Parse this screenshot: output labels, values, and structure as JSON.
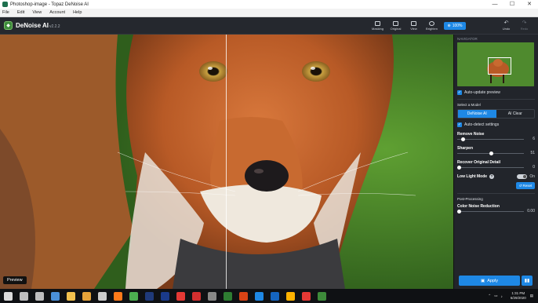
{
  "window": {
    "title": "Photoshop-image - Topaz DeNoise AI",
    "controls": {
      "minimize": "—",
      "maximize": "☐",
      "close": "✕"
    }
  },
  "menu": [
    "File",
    "Edit",
    "View",
    "Account",
    "Help"
  ],
  "app": {
    "name": "DeNoise AI",
    "version": "v2.2.2"
  },
  "toolbar": {
    "tools": [
      {
        "label": "Masking",
        "icon": "masking-icon"
      },
      {
        "label": "Original",
        "icon": "original-icon"
      },
      {
        "label": "View",
        "icon": "view-icon"
      },
      {
        "label": "Brighten",
        "icon": "brighten-icon"
      }
    ],
    "zoom": "100%",
    "undo": "Undo",
    "redo": "Redo"
  },
  "canvas": {
    "preview_label": "Preview"
  },
  "panel": {
    "navigator_title": "NAVIGATOR",
    "auto_update_preview": "Auto-update preview",
    "select_model": "Select a Model",
    "models": [
      {
        "label": "DeNoise AI",
        "active": true
      },
      {
        "label": "AI Clear",
        "active": false
      }
    ],
    "auto_detect": "Auto-detect settings",
    "sliders": [
      {
        "label": "Remove Noise",
        "value": "6",
        "fraction": 0.06
      },
      {
        "label": "Sharpen",
        "value": "51",
        "fraction": 0.51
      },
      {
        "label": "Recover Original Detail",
        "value": "0",
        "fraction": 0.0
      }
    ],
    "low_light": {
      "label": "Low Light Mode",
      "help": "?",
      "state": "On"
    },
    "reset": "Reset",
    "post_processing": "Post-Processing",
    "color_noise": {
      "label": "Color Noise Reduction",
      "value": "0.00",
      "fraction": 0.0
    },
    "apply": "Apply"
  },
  "taskbar": {
    "apps": [
      "windows-start-icon",
      "search-icon",
      "task-view-icon",
      "photos-icon",
      "file-explorer-icon",
      "folder-icon",
      "store-icon",
      "firefox-icon",
      "chrome-icon",
      "lightroom-icon",
      "photoshop-icon",
      "drive-icon",
      "acrobat-icon",
      "calculator-icon",
      "excel-icon",
      "powerpoint-icon",
      "word-icon",
      "edge-icon",
      "sketch-icon",
      "reader-icon",
      "topaz-icon"
    ],
    "time": "1:31 PM",
    "date": "6/29/2020"
  },
  "colors": {
    "accent": "#1e88e5",
    "panel_bg": "#22252b",
    "toolbar_bg": "#25282e"
  }
}
